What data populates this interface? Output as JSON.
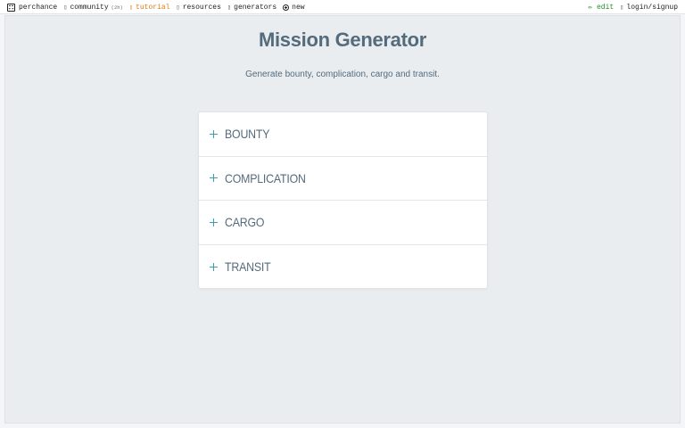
{
  "topbar": {
    "brand": "perchance",
    "community_label": "community",
    "community_count": "(2h)",
    "tutorial_label": "tutorial",
    "resources_label": "resources",
    "generators_label": "generators",
    "new_label": "new",
    "edit_label": "✏ edit",
    "login_label": "login/signup"
  },
  "page": {
    "title": "Mission Generator",
    "subtitle": "Generate bounty, complication, cargo and transit."
  },
  "sections": [
    {
      "label": "BOUNTY"
    },
    {
      "label": "COMPLICATION"
    },
    {
      "label": "CARGO"
    },
    {
      "label": "TRANSIT"
    }
  ],
  "colors": {
    "accent": "#3aa0b0",
    "heading": "#546b7c",
    "tutorial": "#e07b1a",
    "edit": "#2a8a2a"
  }
}
